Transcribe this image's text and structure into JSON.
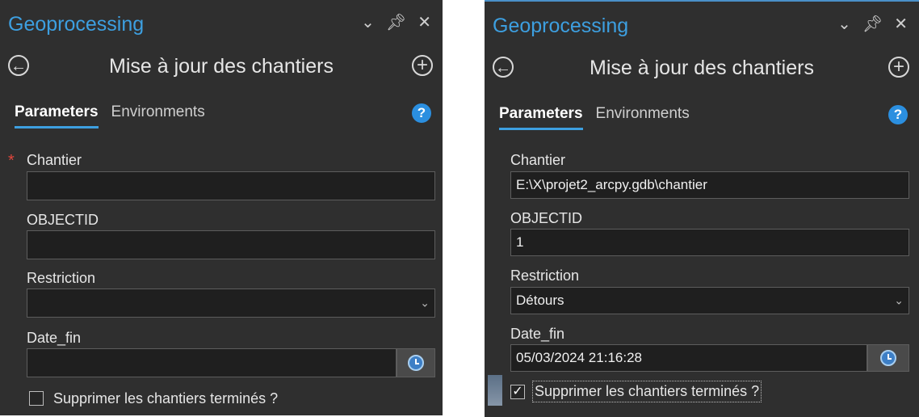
{
  "left": {
    "title": "Geoprocessing",
    "tool_title": "Mise à jour des chantiers",
    "tabs": [
      "Parameters",
      "Environments"
    ],
    "fields": {
      "chantier": {
        "label": "Chantier",
        "value": "",
        "required": true
      },
      "objectid": {
        "label": "OBJECTID",
        "value": ""
      },
      "restriction": {
        "label": "Restriction",
        "value": ""
      },
      "date_fin": {
        "label": "Date_fin",
        "value": ""
      }
    },
    "checkbox": {
      "label": "Supprimer les chantiers terminés ?",
      "checked": false
    }
  },
  "right": {
    "title": "Geoprocessing",
    "tool_title": "Mise à jour des chantiers",
    "tabs": [
      "Parameters",
      "Environments"
    ],
    "fields": {
      "chantier": {
        "label": "Chantier",
        "value": "E:\\X\\projet2_arcpy.gdb\\chantier"
      },
      "objectid": {
        "label": "OBJECTID",
        "value": "1"
      },
      "restriction": {
        "label": "Restriction",
        "value": "Détours"
      },
      "date_fin": {
        "label": "Date_fin",
        "value": "05/03/2024 21:16:28"
      }
    },
    "checkbox": {
      "label": "Supprimer les chantiers terminés ?",
      "checked": true,
      "mark": "✓"
    }
  },
  "icons": {
    "window": [
      "chevron-down-icon",
      "pin-icon",
      "close-icon"
    ],
    "glyphs": {
      "chevron": "⌄",
      "pin": "ᵼ",
      "close": "✕",
      "back": "←",
      "add": "+",
      "help": "?",
      "select_chevron": "⌄"
    }
  },
  "colors": {
    "panel_bg": "#2f2f2f",
    "title_blue": "#3d9fe0",
    "input_bg": "#1f1f1f",
    "required_red": "#e0463c"
  }
}
